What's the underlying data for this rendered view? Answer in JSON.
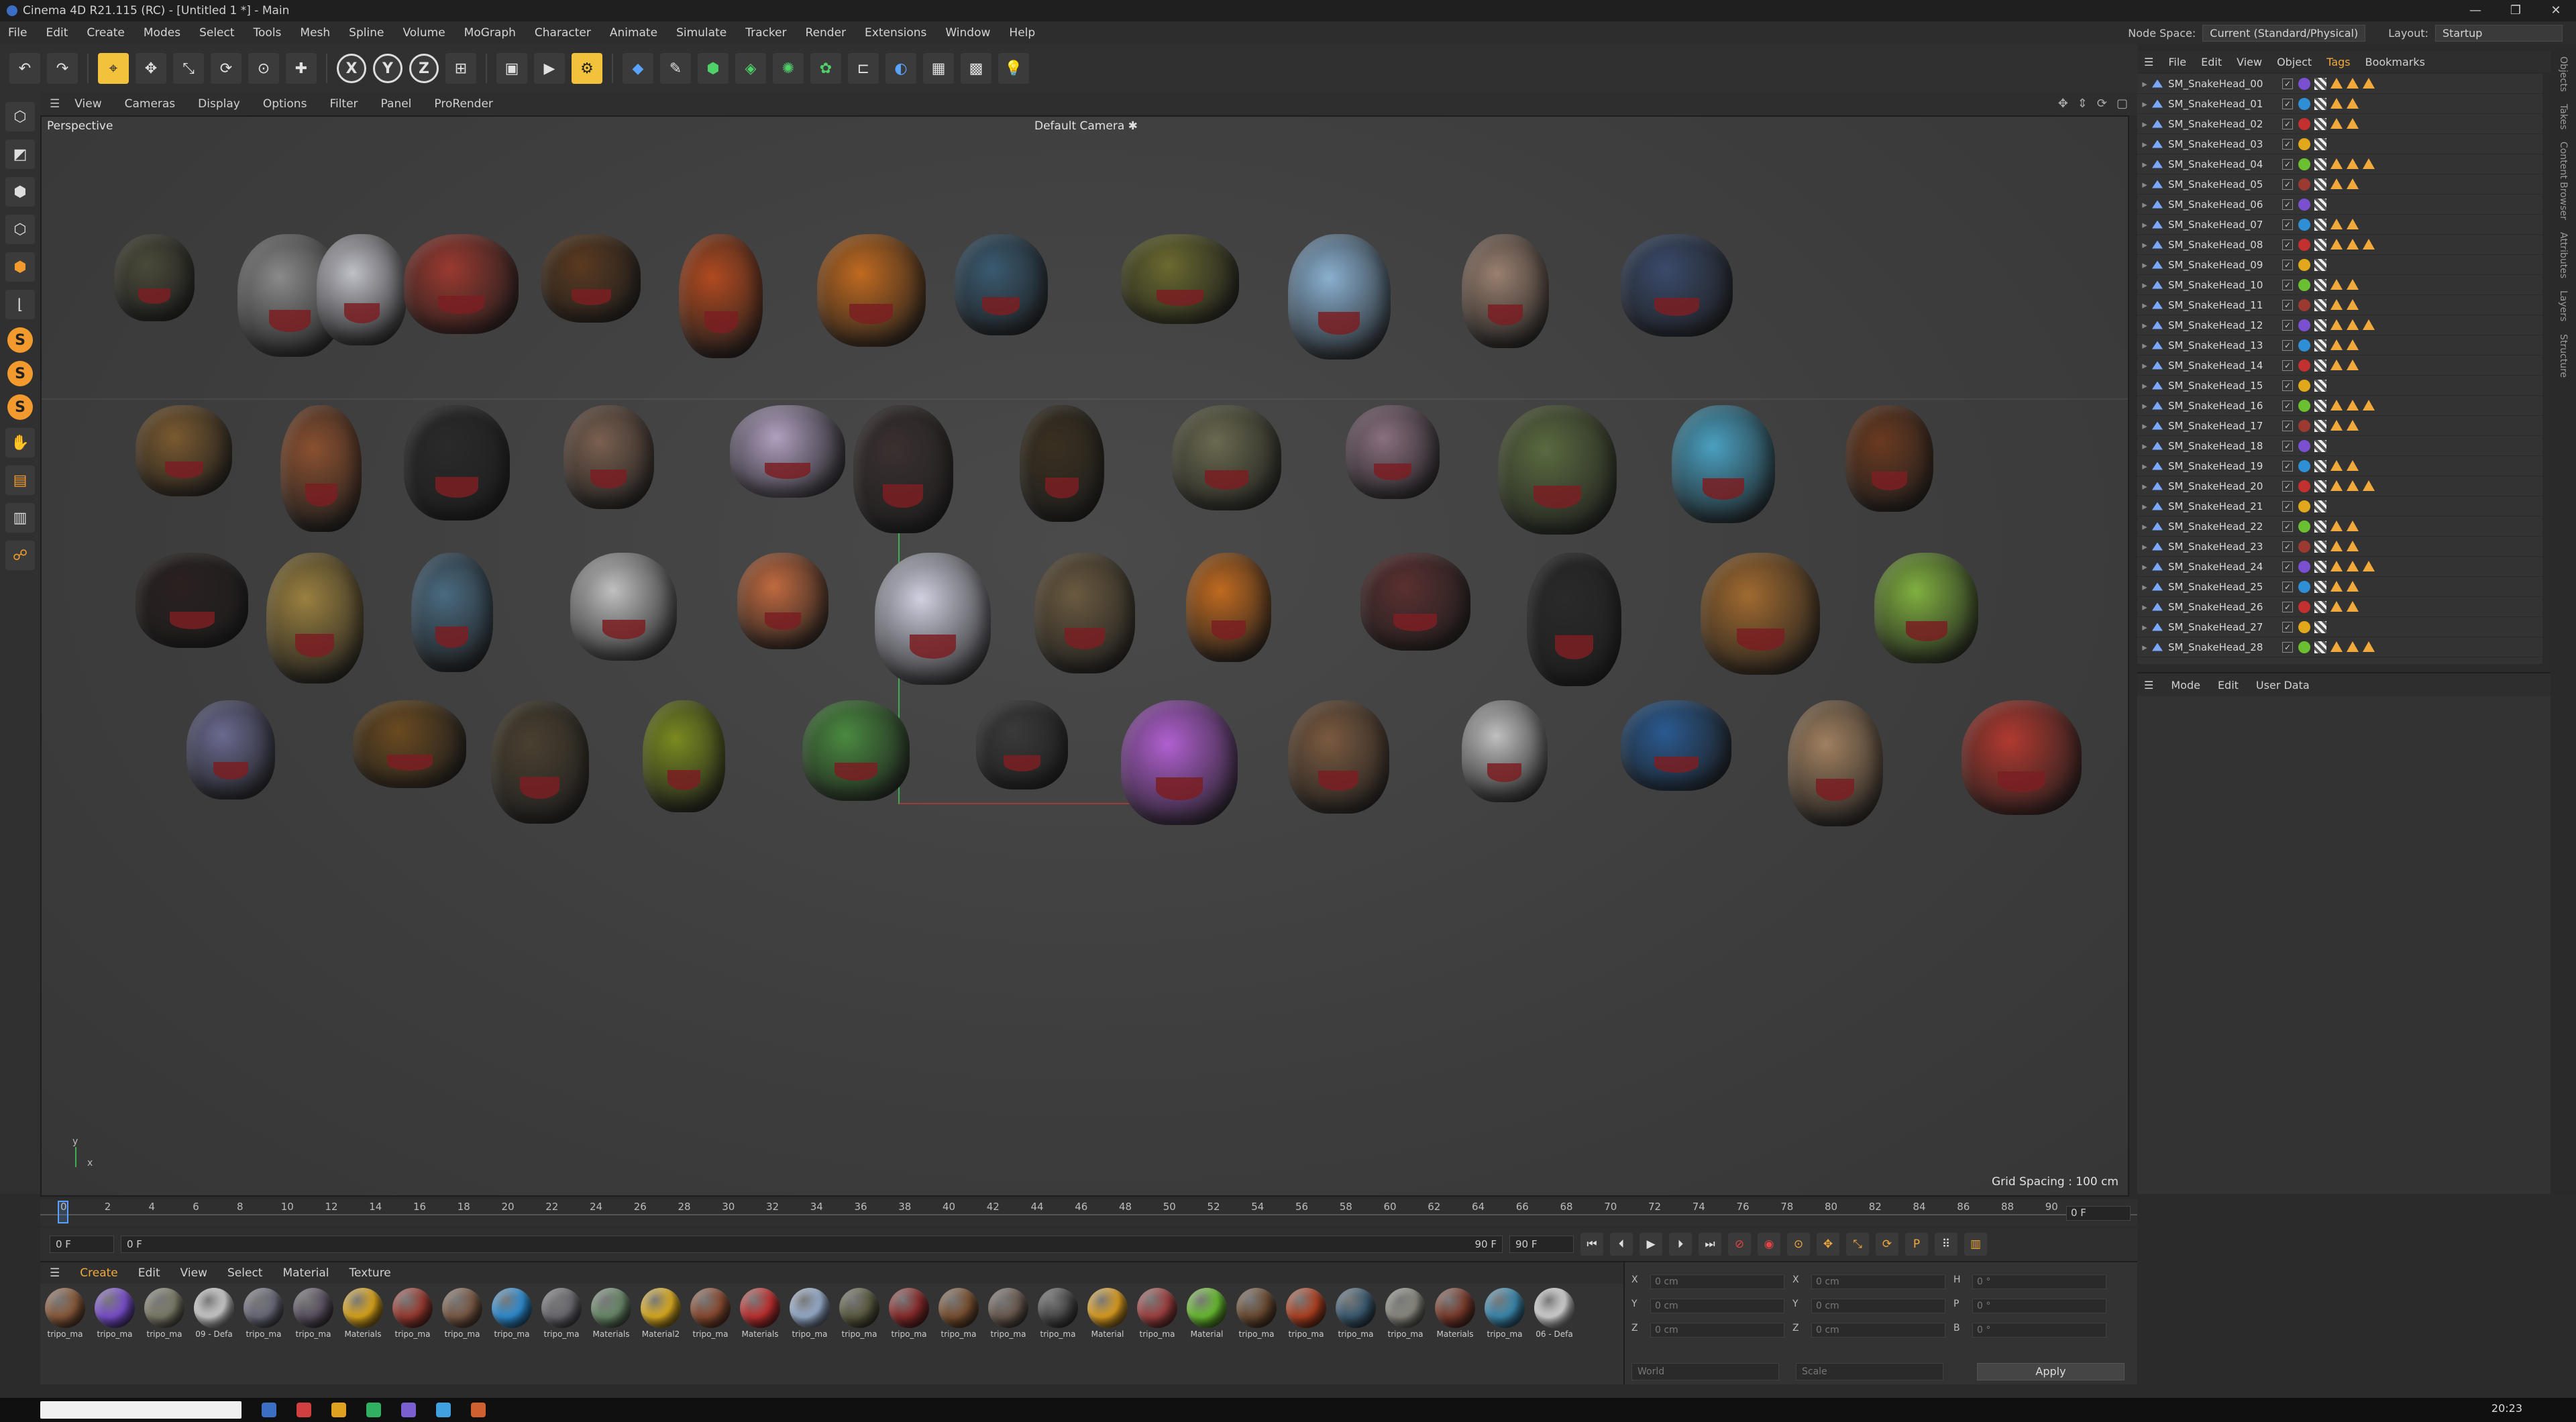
{
  "window": {
    "title": "Cinema 4D R21.115 (RC) - [Untitled 1 *] - Main",
    "controls": [
      "—",
      "❐",
      "✕"
    ]
  },
  "menu": {
    "items": [
      "File",
      "Edit",
      "Create",
      "Modes",
      "Select",
      "Tools",
      "Mesh",
      "Spline",
      "Volume",
      "MoGraph",
      "Character",
      "Animate",
      "Simulate",
      "Tracker",
      "Render",
      "Extensions",
      "Window",
      "Help"
    ],
    "node_space_label": "Node Space:",
    "node_space_value": "Current (Standard/Physical)",
    "layout_label": "Layout:",
    "layout_value": "Startup"
  },
  "viewport": {
    "menu": [
      "View",
      "Cameras",
      "Display",
      "Options",
      "Filter",
      "Panel",
      "ProRender"
    ],
    "view_name": "Perspective",
    "camera": "Default Camera",
    "camera_icon": "✱",
    "grid_spacing": "Grid Spacing : 100 cm",
    "gizmo_y": "y",
    "gizmo_x": "x"
  },
  "object_manager": {
    "menu": [
      "File",
      "Edit",
      "View",
      "Object",
      "Tags",
      "Bookmarks"
    ],
    "objects": [
      "SM_SnakeHead_00",
      "SM_SnakeHead_01",
      "SM_SnakeHead_02",
      "SM_SnakeHead_03",
      "SM_SnakeHead_04",
      "SM_SnakeHead_05",
      "SM_SnakeHead_06",
      "SM_SnakeHead_07",
      "SM_SnakeHead_08",
      "SM_SnakeHead_09",
      "SM_SnakeHead_10",
      "SM_SnakeHead_11",
      "SM_SnakeHead_12",
      "SM_SnakeHead_13",
      "SM_SnakeHead_14",
      "SM_SnakeHead_15",
      "SM_SnakeHead_16",
      "SM_SnakeHead_17",
      "SM_SnakeHead_18",
      "SM_SnakeHead_19",
      "SM_SnakeHead_20",
      "SM_SnakeHead_21",
      "SM_SnakeHead_22",
      "SM_SnakeHead_23",
      "SM_SnakeHead_24",
      "SM_SnakeHead_25",
      "SM_SnakeHead_26",
      "SM_SnakeHead_27",
      "SM_SnakeHead_28"
    ]
  },
  "side_tabs": [
    "Objects",
    "Takes",
    "Content Browser",
    "Attributes",
    "Layers",
    "Structure"
  ],
  "attributes": {
    "menu": [
      "Mode",
      "Edit",
      "User Data"
    ]
  },
  "timeline": {
    "ticks": [
      "0",
      "2",
      "4",
      "6",
      "8",
      "10",
      "12",
      "14",
      "16",
      "18",
      "20",
      "22",
      "24",
      "26",
      "28",
      "30",
      "32",
      "34",
      "36",
      "38",
      "40",
      "42",
      "44",
      "46",
      "48",
      "50",
      "52",
      "54",
      "56",
      "58",
      "60",
      "62",
      "64",
      "66",
      "68",
      "70",
      "72",
      "74",
      "76",
      "78",
      "80",
      "82",
      "84",
      "86",
      "88",
      "90"
    ],
    "current_frame": "0 F",
    "start_frame": "0 F",
    "range_start": "0 F",
    "range_end": "90 F",
    "end_frame": "90 F"
  },
  "materials": {
    "menu": [
      "Create",
      "Edit",
      "View",
      "Select",
      "Material",
      "Texture"
    ],
    "items": [
      {
        "label": "tripo_ma",
        "color": "#8a5a3a"
      },
      {
        "label": "tripo_ma",
        "color": "#7a4fd0"
      },
      {
        "label": "tripo_ma",
        "color": "#7d7d6a"
      },
      {
        "label": "09 - Defa",
        "color": "#d0d0d0"
      },
      {
        "label": "tripo_ma",
        "color": "#6a6a7a"
      },
      {
        "label": "tripo_ma",
        "color": "#5a5060"
      },
      {
        "label": "Materials",
        "color": "#e0a81a"
      },
      {
        "label": "tripo_ma",
        "color": "#9a3a30"
      },
      {
        "label": "tripo_ma",
        "color": "#7a5a45"
      },
      {
        "label": "tripo_ma",
        "color": "#2e8fd6"
      },
      {
        "label": "tripo_ma",
        "color": "#6a6a70"
      },
      {
        "label": "Materials",
        "color": "#6a8a6a"
      },
      {
        "label": "Material2",
        "color": "#e0b020"
      },
      {
        "label": "tripo_ma",
        "color": "#8a4a30"
      },
      {
        "label": "Materials",
        "color": "#c23030"
      },
      {
        "label": "tripo_ma",
        "color": "#9ab0d0"
      },
      {
        "label": "tripo_ma",
        "color": "#5a5a40"
      },
      {
        "label": "tripo_ma",
        "color": "#8a2a2a"
      },
      {
        "label": "tripo_ma",
        "color": "#7a5030"
      },
      {
        "label": "tripo_ma",
        "color": "#6a5a50"
      },
      {
        "label": "tripo_ma",
        "color": "#4a4a4a"
      },
      {
        "label": "Material",
        "color": "#e0a020"
      },
      {
        "label": "tripo_ma",
        "color": "#a04040"
      },
      {
        "label": "Material",
        "color": "#6ac030"
      },
      {
        "label": "tripo_ma",
        "color": "#6a4a30"
      },
      {
        "label": "tripo_ma",
        "color": "#b04020"
      },
      {
        "label": "tripo_ma",
        "color": "#3a5a70"
      },
      {
        "label": "tripo_ma",
        "color": "#8a8a80"
      },
      {
        "label": "Materials",
        "color": "#7a3a2a"
      },
      {
        "label": "tripo_ma",
        "color": "#3a8ab0"
      },
      {
        "label": "06 - Defa",
        "color": "#d8d8d8"
      }
    ]
  },
  "coordinates": {
    "rows": [
      {
        "a": "X",
        "v1": "0 cm",
        "b": "X",
        "v2": "0 cm",
        "c": "H",
        "v3": "0 °"
      },
      {
        "a": "Y",
        "v1": "0 cm",
        "b": "Y",
        "v2": "0 cm",
        "c": "P",
        "v3": "0 °"
      },
      {
        "a": "Z",
        "v1": "0 cm",
        "b": "Z",
        "v2": "0 cm",
        "c": "B",
        "v3": "0 °"
      }
    ],
    "mode1": "World",
    "mode2": "Scale",
    "apply": "Apply"
  },
  "taskbar": {
    "clock": "20:23"
  }
}
